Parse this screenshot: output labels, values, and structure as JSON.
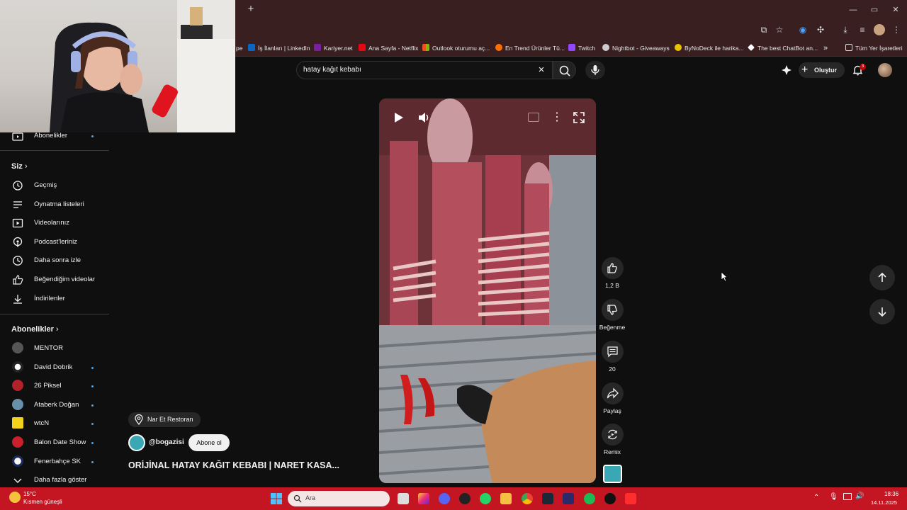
{
  "browser": {
    "new_tab_icon": "+",
    "bookmarks": [
      {
        "label": "pe",
        "icon_color": "#c33"
      },
      {
        "label": "İş İlanları | LinkedIn",
        "icon_color": "#0a66c2"
      },
      {
        "label": "Kariyer.net",
        "icon_color": "#7b1fa2"
      },
      {
        "label": "Ana Sayfa - Netflix",
        "icon_color": "#e50914"
      },
      {
        "label": "Outlook oturumu aç...",
        "icon_color": "#f4b400"
      },
      {
        "label": "En Trend Ürünler Tü...",
        "icon_color": "#ff6f00"
      },
      {
        "label": "Twitch",
        "icon_color": "#9146ff"
      },
      {
        "label": "Nightbot - Giveaways",
        "icon_color": "#cccccc"
      },
      {
        "label": "ByNoDeck ile harika...",
        "icon_color": "#e8c400"
      },
      {
        "label": "The best ChatBot an...",
        "icon_color": "#ffffff"
      },
      {
        "label": "»",
        "icon_color": ""
      },
      {
        "label": "Tüm Yer İşaretleri",
        "icon_color": "#dddddd"
      }
    ]
  },
  "youtube": {
    "search_query": "hatay kağıt kebabı",
    "create_label": "Oluştur",
    "notification_count": "3"
  },
  "sidebar": {
    "top_item": "Abonelikler",
    "you_header": "Siz",
    "you_items": [
      {
        "label": "Geçmiş",
        "icon": "history-icon"
      },
      {
        "label": "Oynatma listeleri",
        "icon": "playlists-icon"
      },
      {
        "label": "Videolarınız",
        "icon": "your-videos-icon"
      },
      {
        "label": "Podcast'leriniz",
        "icon": "podcast-icon"
      },
      {
        "label": "Daha sonra izle",
        "icon": "watch-later-icon"
      },
      {
        "label": "Beğendiğim videolar",
        "icon": "liked-icon"
      },
      {
        "label": "İndirilenler",
        "icon": "download-icon"
      }
    ],
    "subs_header": "Abonelikler",
    "subscriptions": [
      {
        "label": "MENTOR",
        "color": "#555",
        "dot": false
      },
      {
        "label": "David Dobrik",
        "color": "#fff",
        "dot": true
      },
      {
        "label": "26 Piksel",
        "color": "#b2222b",
        "dot": true
      },
      {
        "label": "Ataberk Doğan",
        "color": "#6a8fa8",
        "dot": true
      },
      {
        "label": "wtcN",
        "color": "#f2d21a",
        "dot": true
      },
      {
        "label": "Balon Date Show",
        "color": "#c9202b",
        "dot": true
      },
      {
        "label": "Fenerbahçe SK",
        "color": "#f4f4f4",
        "dot": true
      }
    ],
    "show_more": "Daha fazla göster"
  },
  "short": {
    "likes": "1,2 B",
    "dislike_label": "Beğenme",
    "comments": "20",
    "share_label": "Paylaş",
    "remix_label": "Remix",
    "location": "Nar Et Restoran",
    "channel": "@bogazisi",
    "subscribe_label": "Abone ol",
    "title": "ORİJİNAL HATAY KAĞIT KEBABI | NARET KASA..."
  },
  "taskbar": {
    "weather_temp": "15°C",
    "weather_desc": "Kısmen güneşli",
    "search_placeholder": "Ara",
    "time": "18:36",
    "date": "14.11.2025"
  }
}
